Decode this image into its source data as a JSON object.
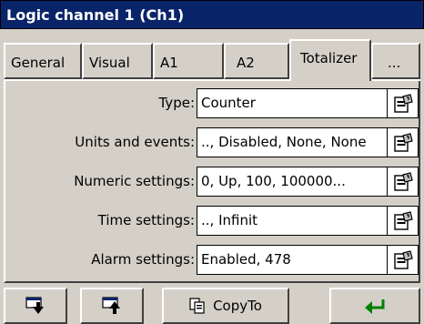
{
  "window": {
    "title": "Logic channel 1 (Ch1)"
  },
  "tabs": [
    {
      "label": "General"
    },
    {
      "label": "Visual"
    },
    {
      "label": "A1"
    },
    {
      "label": "A2"
    },
    {
      "label": "Totalizer",
      "active": true
    },
    {
      "label": "..."
    }
  ],
  "fields": [
    {
      "label": "Type:",
      "value": "Counter"
    },
    {
      "label": "Units and events:",
      "value": ".., Disabled, None, None"
    },
    {
      "label": "Numeric settings:",
      "value": "0, Up, 100, 100000..."
    },
    {
      "label": "Time settings:",
      "value": ".., Infinit"
    },
    {
      "label": "Alarm settings:",
      "value": "Enabled, 478"
    }
  ],
  "bottombar": {
    "copyto_label": "CopyTo",
    "icons": [
      "move-down-icon",
      "move-up-icon",
      "copy-icon",
      "enter-icon"
    ],
    "enter_color": "#008000"
  },
  "colors": {
    "titlebar": "#0a246a",
    "face": "#d4d0c8"
  }
}
